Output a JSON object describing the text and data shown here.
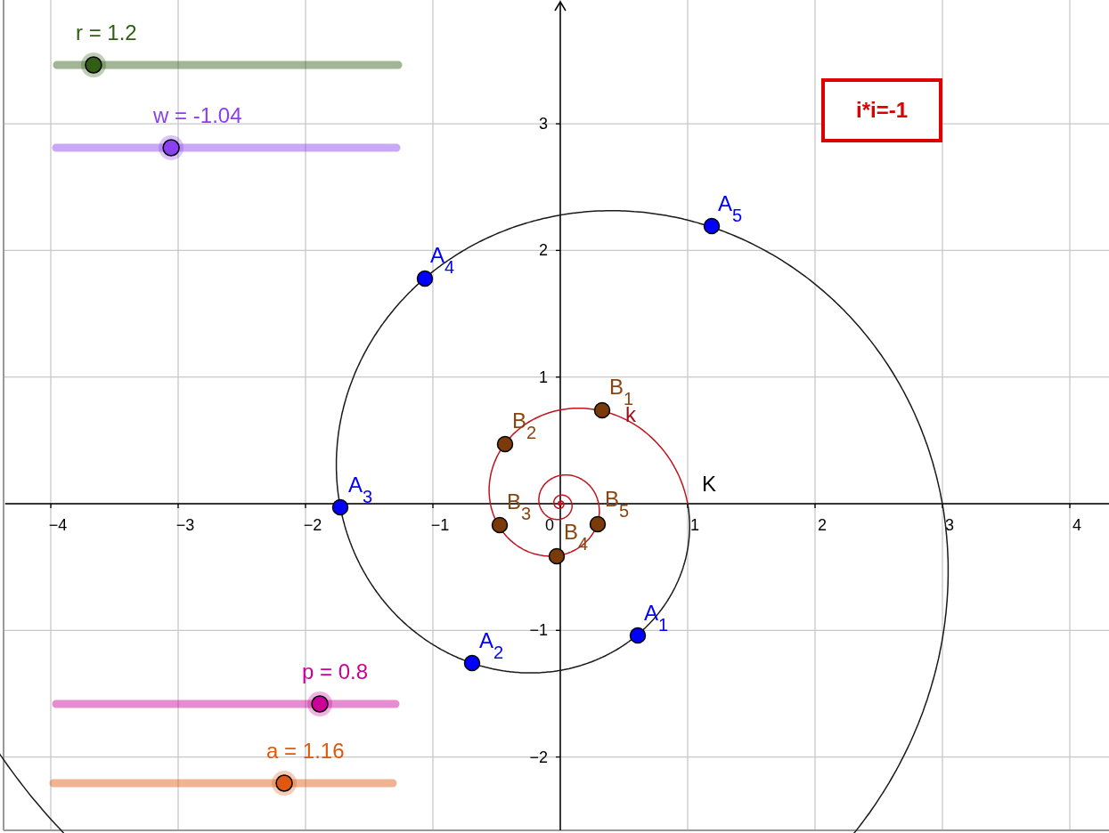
{
  "sliders": [
    {
      "label": "r = 1.2",
      "level": 0.107,
      "color": "#2f5e14"
    },
    {
      "label": "w = -1.04",
      "level": 0.338,
      "color": "#8a3ff0"
    },
    {
      "label": "p = 0.8",
      "level": 0.777,
      "color": "#cc0099"
    },
    {
      "label": "a = 1.16",
      "level": 0.68,
      "color": "#e0580f"
    }
  ],
  "x_ticks": [
    "−4",
    "−3",
    "−2",
    "−1",
    "0",
    "1",
    "2",
    "3",
    "4"
  ],
  "y_ticks": [
    "3",
    "2",
    "1",
    "−1",
    "−2"
  ],
  "points": [
    {
      "name": "A",
      "index": "1",
      "color": "#0000ff"
    },
    {
      "name": "A",
      "index": "2",
      "color": "#0000ff"
    },
    {
      "name": "A",
      "index": "3",
      "color": "#0000ff"
    },
    {
      "name": "A",
      "index": "4",
      "color": "#0000ff"
    },
    {
      "name": "A",
      "index": "5",
      "color": "#0000ff"
    },
    {
      "name": "B",
      "index": "1",
      "color": "#7a3a0a"
    },
    {
      "name": "B",
      "index": "2",
      "color": "#7a3a0a"
    },
    {
      "name": "B",
      "index": "3",
      "color": "#7a3a0a"
    },
    {
      "name": "B",
      "index": "4",
      "color": "#7a3a0a"
    },
    {
      "name": "B",
      "index": "5",
      "color": "#7a3a0a"
    }
  ],
  "curve_labels": [
    "K",
    "k"
  ],
  "text_box": "i*i=-1"
}
